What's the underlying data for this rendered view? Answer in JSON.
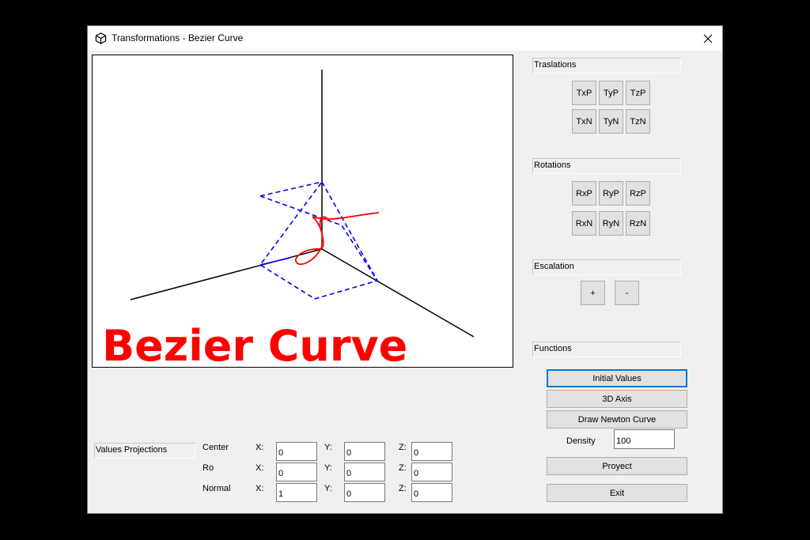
{
  "window": {
    "title": "Transformations - Bezier Curve",
    "icon": "cube-icon",
    "close_icon": "close-icon"
  },
  "canvas": {
    "banner_text": "Bezier Curve",
    "banner_color": "#ff0000",
    "axis_color": "#000000",
    "plane_color": "#0000ff",
    "curve_color": "#ff0000"
  },
  "translations": {
    "label": "Traslations",
    "buttons": [
      "TxP",
      "TyP",
      "TzP",
      "TxN",
      "TyN",
      "TzN"
    ]
  },
  "rotations": {
    "label": "Rotations",
    "buttons": [
      "RxP",
      "RyP",
      "RzP",
      "RxN",
      "RyN",
      "RzN"
    ]
  },
  "escalation": {
    "label": "Escalation",
    "plus": "+",
    "minus": "-"
  },
  "functions": {
    "label": "Functions",
    "initial_values": "Initial Values",
    "axis_3d": "3D Axis",
    "draw_newton": "Draw Newton Curve",
    "density_label": "Density",
    "density_value": "100",
    "proyect": "Proyect",
    "exit": "Exit"
  },
  "projections": {
    "label": "Values Projections",
    "x_label": "X:",
    "y_label": "Y:",
    "z_label": "Z:",
    "rows": [
      {
        "name": "Center",
        "x": "0",
        "y": "0",
        "z": "0"
      },
      {
        "name": "Ro",
        "x": "0",
        "y": "0",
        "z": "0"
      },
      {
        "name": "Normal",
        "x": "1",
        "y": "0",
        "z": "0"
      }
    ]
  }
}
